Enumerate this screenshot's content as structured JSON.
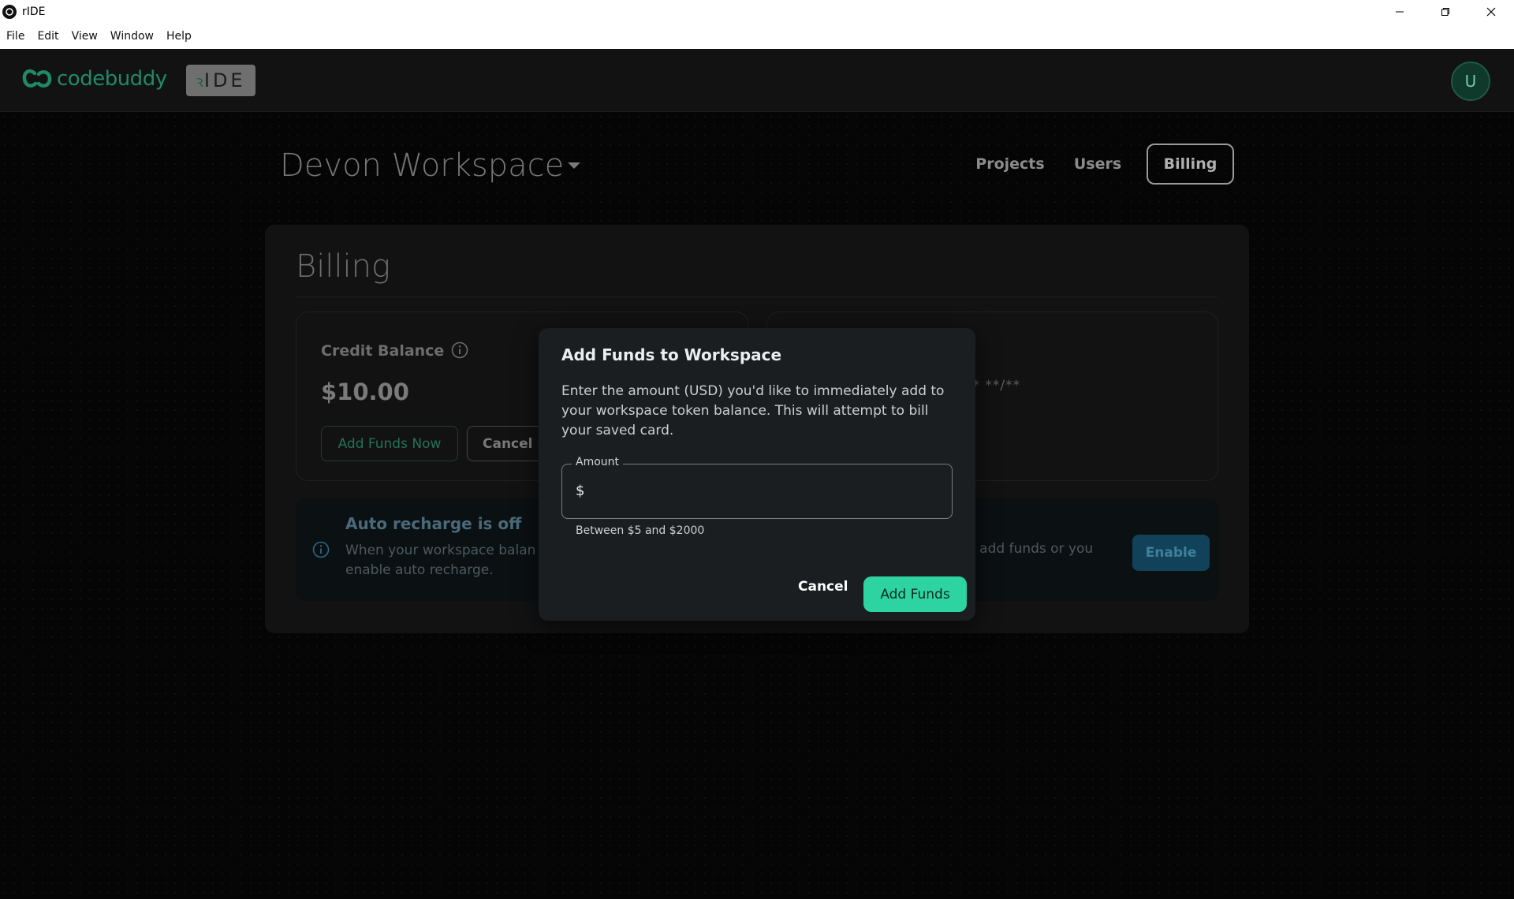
{
  "window": {
    "title": "rIDE"
  },
  "menu": [
    "File",
    "Edit",
    "View",
    "Window",
    "Help"
  ],
  "header": {
    "logo_text": "codebuddy",
    "ide_badge": "IDE",
    "avatar_initial": "U"
  },
  "workspace": {
    "name": "Devon Workspace"
  },
  "nav": {
    "projects": "Projects",
    "users": "Users",
    "billing": "Billing"
  },
  "billing": {
    "heading": "Billing",
    "credit_label": "Credit Balance",
    "credit_value": "$10.00",
    "add_funds_now": "Add Funds Now",
    "cancel_partial": "Cancel P",
    "card_mask": "** **/**",
    "recharge_title": "Auto recharge is off",
    "recharge_desc_line1": "When your workspace balan",
    "recharge_desc_line2": "enable auto recharge.",
    "recharge_desc_right": "u add funds or you",
    "enable_button": "Enable"
  },
  "modal": {
    "title": "Add Funds to Workspace",
    "description": "Enter the amount (USD) you'd like to immediately add to your workspace token balance. This will attempt to bill your saved card.",
    "amount_label": "Amount",
    "amount_prefix": "$",
    "amount_value": "",
    "amount_hint": "Between $5 and $2000",
    "cancel_label": "Cancel",
    "submit_label": "Add Funds"
  },
  "colors": {
    "accent": "#2dd4a1",
    "brand": "#1f8a68",
    "info": "#3f7f9a"
  },
  "icons": [
    "app-icon",
    "minimize-icon",
    "restore-icon",
    "close-icon",
    "codebuddy-logo-icon",
    "chevron-down-icon",
    "info-icon"
  ]
}
